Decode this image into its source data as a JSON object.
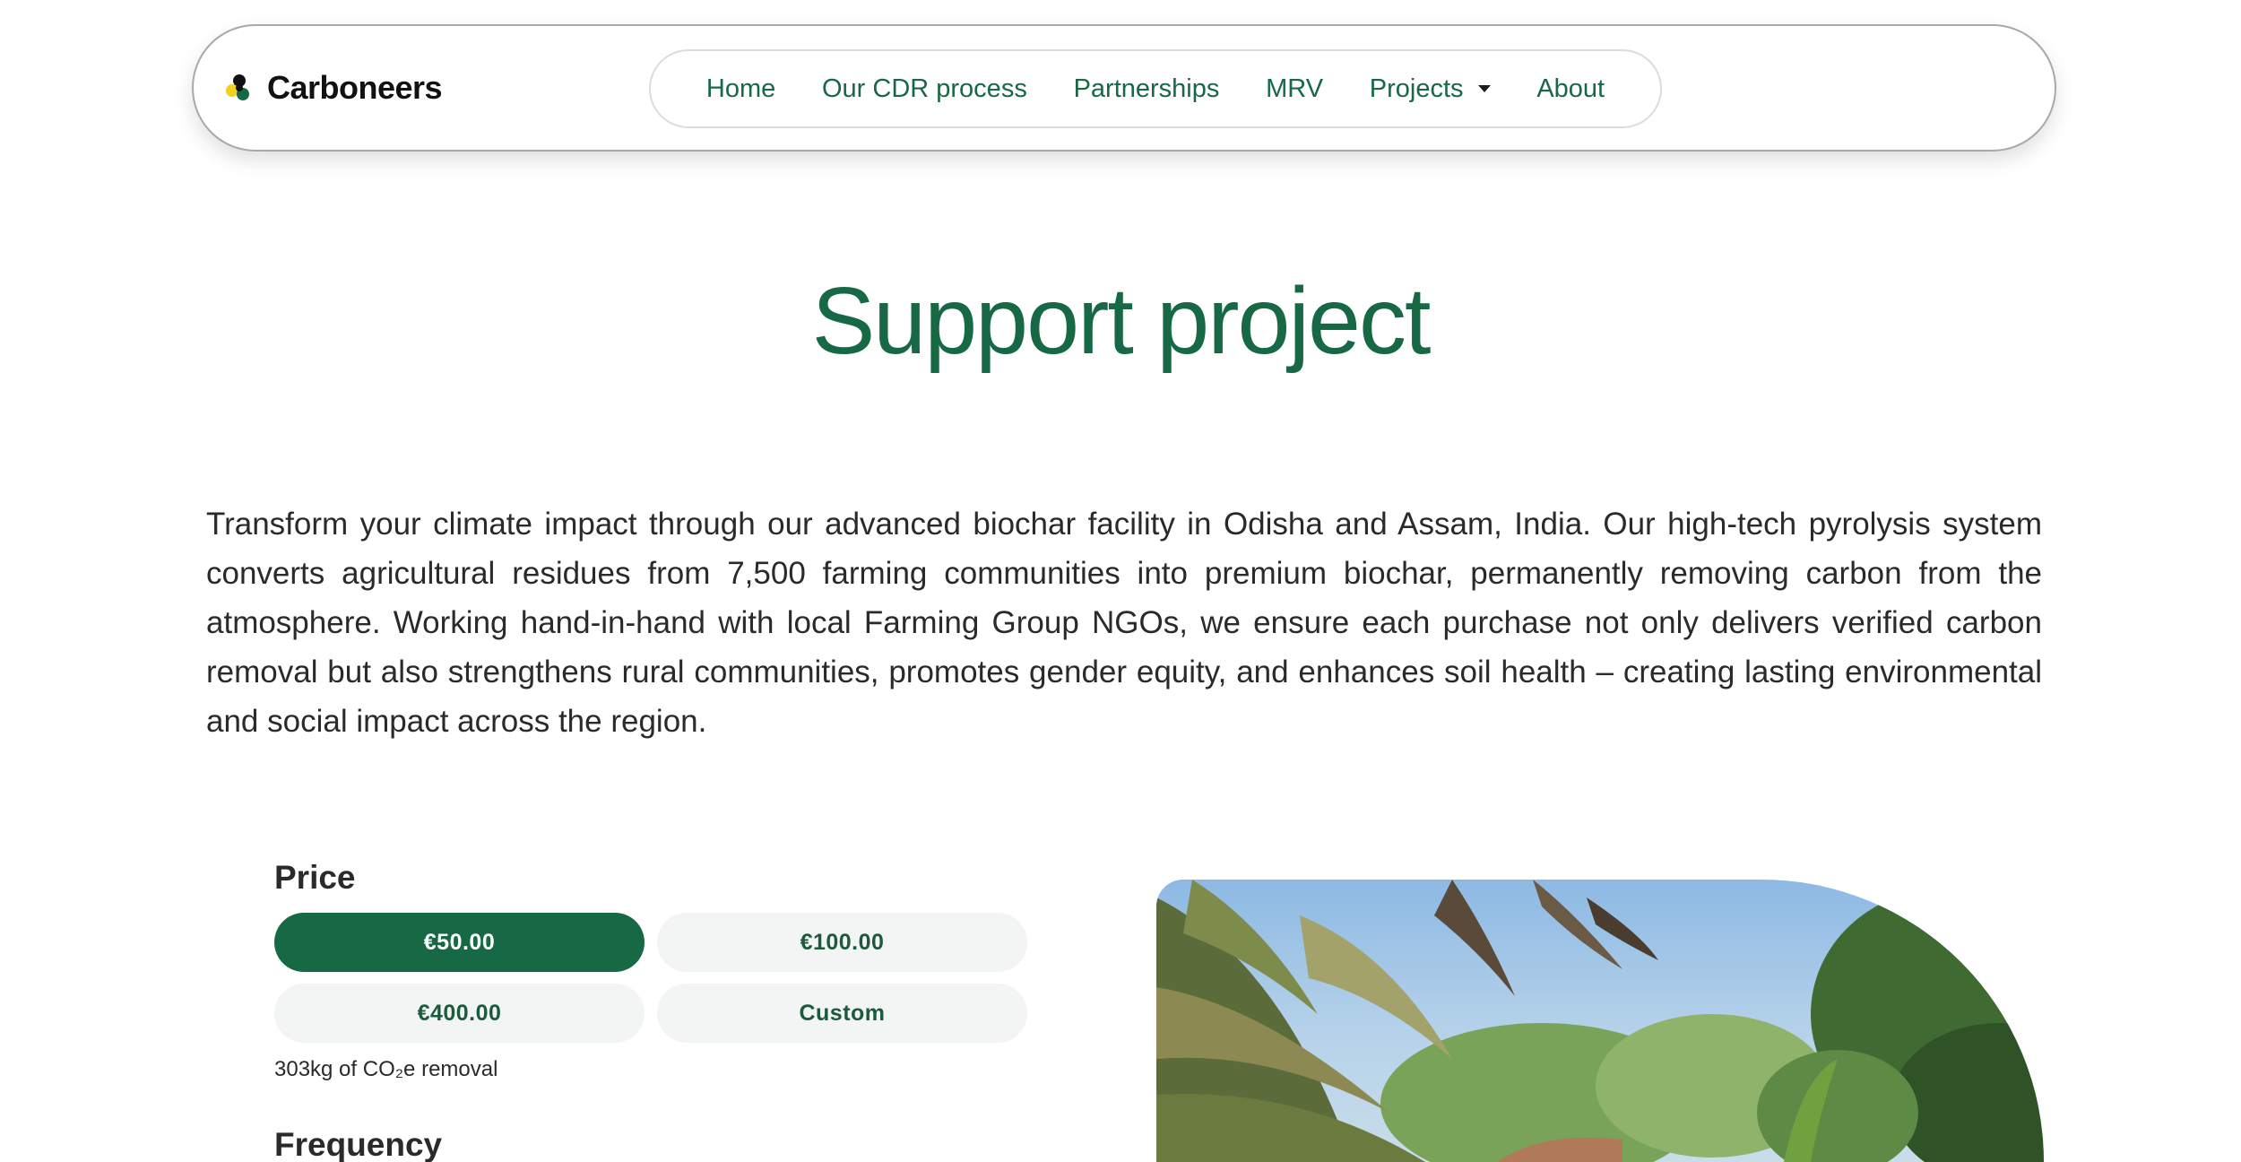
{
  "header": {
    "brand_name": "Carboneers",
    "nav": [
      {
        "label": "Home"
      },
      {
        "label": "Our CDR process"
      },
      {
        "label": "Partnerships"
      },
      {
        "label": "MRV"
      },
      {
        "label": "Projects"
      },
      {
        "label": "About"
      }
    ]
  },
  "main": {
    "title": "Support project",
    "description": "Transform your climate impact through our advanced biochar facility in Odisha and Assam, India. Our high-tech pyrolysis system converts agricultural residues from 7,500 farming communities into premium biochar, permanently removing carbon from the atmosphere. Working hand-in-hand with local Farming Group NGOs, we ensure each purchase not only delivers verified carbon removal but also strengthens rural communities, promotes gender equity, and enhances soil health – creating lasting environmental and social impact across the region."
  },
  "price": {
    "heading": "Price",
    "options": [
      {
        "label": "€50.00",
        "selected": true
      },
      {
        "label": "€100.00",
        "selected": false
      },
      {
        "label": "€400.00",
        "selected": false
      },
      {
        "label": "Custom",
        "selected": false
      }
    ],
    "removal_note": "303kg of CO₂e removal"
  },
  "frequency": {
    "heading": "Frequency"
  },
  "colors": {
    "brand_green": "#176844",
    "logo_yellow": "#f2d21b",
    "text": "#2a2a2a",
    "pill_bg": "#f3f5f4"
  },
  "icons": {
    "logo": "carboneers-logo-icon",
    "projects_dropdown": "caret-down-icon"
  }
}
